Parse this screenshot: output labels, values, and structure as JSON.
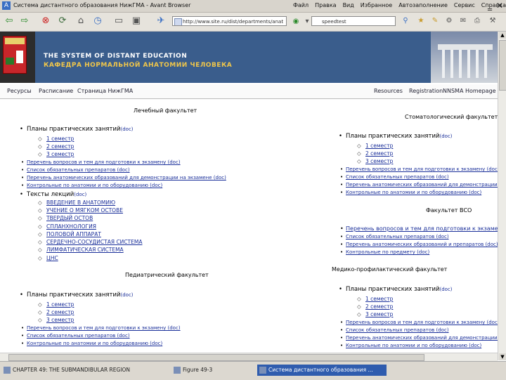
{
  "window": {
    "title": "Система дистантного образования НижГМА - Avant Browser",
    "menu": [
      "Файл",
      "Правка",
      "Вид",
      "Избранное",
      "Автозаполнение",
      "Сервис",
      "Справка"
    ]
  },
  "toolbar": {
    "address": "http://www.site.ru/dist/departments/anat",
    "search_value": "speedtest"
  },
  "banner": {
    "line1": "THE SYSTEM OF DISTANT EDUCATION",
    "line2": "КАФЕДРА НОРМАЛЬНОЙ АНАТОМИИ ЧЕЛОВЕКА"
  },
  "nav": {
    "left": [
      "Ресурсы",
      "Расписание",
      "Страница НижГМА"
    ],
    "right": [
      "Resources",
      "Registration",
      "NNSMA Homepage"
    ]
  },
  "left": {
    "lech": {
      "heading": "Лечебный факультет",
      "plans": "Планы практических занятий",
      "plans_doc": "(doc)",
      "semesters": [
        "1 семестр",
        "2 семестр",
        "3 семестр"
      ],
      "links": [
        "Перечень вопросов и тем для подготовки к экзамену (doc)",
        "Список обязательных препаратов (doc)",
        "Перечень анатомических образований для демонстрации на экзамене (doc)",
        "Контрольные по анатомии и по оборудованию (doc)"
      ],
      "texts": "Тексты лекций",
      "texts_doc": "(doc)",
      "lectures": [
        "ВВЕДЕНИЕ В АНАТОМИЮ",
        "УЧЕНИЕ О МЯГКОМ ОСТОВЕ",
        "ТВЕРДЫЙ ОСТОВ",
        "СПЛАНХНОЛОГИЯ",
        "ПОЛОВОЙ АППАРАТ",
        "СЕРДЕЧНО-СОСУДИСТАЯ СИСТЕМА",
        "ЛИМФАТИЧЕСКАЯ СИСТЕМА",
        "ЦНС"
      ]
    },
    "ped": {
      "heading": "Педиатрический факультет",
      "plans": "Планы практических занятий",
      "plans_doc": "(doc)",
      "semesters": [
        "1 семестр",
        "2 семестр",
        "3 семестр"
      ],
      "links": [
        "Перечень вопросов и тем для подготовки к экзамену (doc)",
        "Список обязательных препаратов (doc)",
        "Контрольные по анатомии и по оборудованию (doc)"
      ]
    }
  },
  "right": {
    "stom": {
      "heading": "Стоматологический факультет",
      "plans": "Планы практических занятий",
      "plans_doc": "(doc)",
      "semesters": [
        "1 семестр",
        "2 семестр",
        "3 семестр"
      ],
      "links": [
        "Перечень вопросов и тем для подготовки к экзамену (doc)",
        "Список обязательных препаратов (doc)",
        "Перечень анатомических образований для демонстрации на экз",
        "Контрольные по анатомии и по оборудованию (doc)"
      ]
    },
    "vso": {
      "heading": "Факультет ВСО",
      "links": [
        "Перечень вопросов и тем для подготовки к экзамену",
        "Список обязательных препаратов (doc)",
        "Перечень анатомических образований и препаратов (doc)",
        "Контрольные по предмету (doc)"
      ]
    },
    "medprof": {
      "heading": "Медико-профилактический факультет",
      "plans": "Планы практических занятий",
      "plans_doc": "(doc)",
      "semesters": [
        "1 семестр",
        "2 семестр",
        "3 семестр"
      ],
      "links": [
        "Перечень вопросов и тем для подготовки к экзамену (doc)",
        "Список обязательных препаратов (doc)",
        "Перечень анатомических образований для демонстрации на экз",
        "Контрольные по анатомии и по оборудованию (doc)"
      ]
    }
  },
  "taskbar": {
    "items": [
      "CHAPTER 49: THE SUBMANDIBULAR REGION",
      "Figure 49-3",
      "Система дистантного образования ..."
    ]
  }
}
